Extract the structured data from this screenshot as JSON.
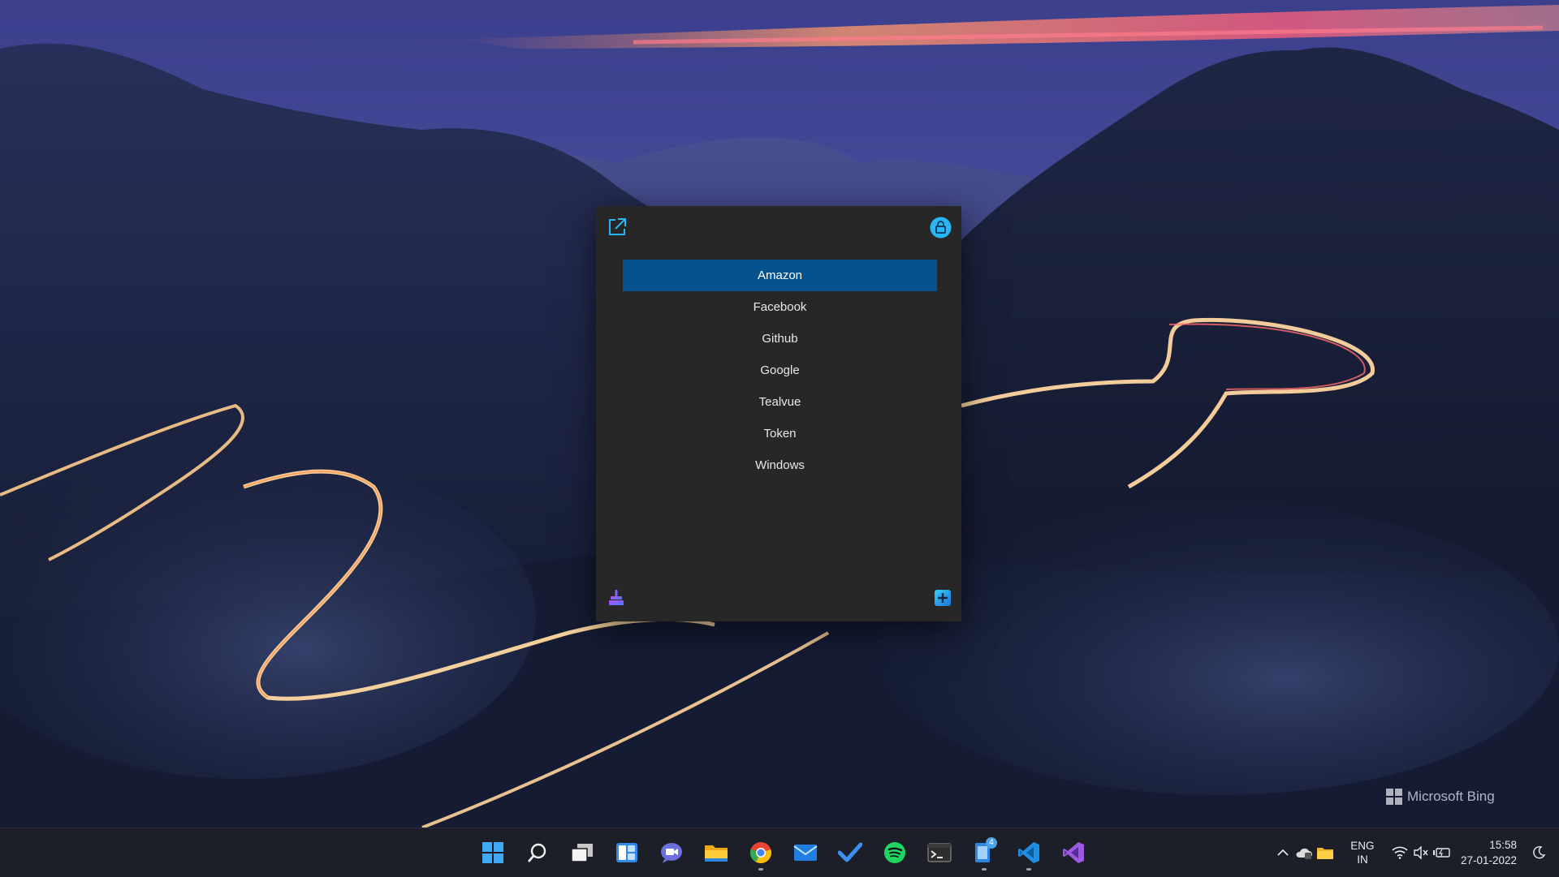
{
  "wallpaper": {
    "watermark": "Microsoft Bing"
  },
  "app": {
    "entries": [
      {
        "label": "Amazon",
        "selected": true
      },
      {
        "label": "Facebook",
        "selected": false
      },
      {
        "label": "Github",
        "selected": false
      },
      {
        "label": "Google",
        "selected": false
      },
      {
        "label": "Tealvue",
        "selected": false
      },
      {
        "label": "Token",
        "selected": false
      },
      {
        "label": "Windows",
        "selected": false
      }
    ],
    "icons": {
      "top_left": "open-external-icon",
      "top_right": "lock-icon",
      "bottom_left": "clean-icon",
      "bottom_right": "add-icon"
    },
    "colors": {
      "background": "#272727",
      "selected": "#06528f",
      "accent": "#29b6f6"
    }
  },
  "taskbar": {
    "apps": [
      {
        "name": "start",
        "icon": "windows-start-icon",
        "running": false
      },
      {
        "name": "search",
        "icon": "search-icon",
        "running": false
      },
      {
        "name": "task-view",
        "icon": "task-view-icon",
        "running": false
      },
      {
        "name": "widgets",
        "icon": "widgets-icon",
        "running": false
      },
      {
        "name": "teams-chat",
        "icon": "chat-icon",
        "running": false
      },
      {
        "name": "file-explorer",
        "icon": "folder-icon",
        "running": false
      },
      {
        "name": "chrome",
        "icon": "chrome-icon",
        "running": true
      },
      {
        "name": "mail",
        "icon": "mail-icon",
        "running": false
      },
      {
        "name": "todo",
        "icon": "checkmark-icon",
        "running": false
      },
      {
        "name": "spotify",
        "icon": "spotify-icon",
        "running": false
      },
      {
        "name": "terminal",
        "icon": "terminal-icon",
        "running": false
      },
      {
        "name": "authenticator",
        "icon": "authenticator-icon",
        "running": true,
        "badge": "4"
      },
      {
        "name": "vscode",
        "icon": "vscode-icon",
        "running": true
      },
      {
        "name": "visual-studio",
        "icon": "visual-studio-icon",
        "running": false
      }
    ],
    "tray": {
      "language": {
        "line1": "ENG",
        "line2": "IN"
      },
      "time": "15:58",
      "date": "27-01-2022",
      "icons": [
        "chevron-up-icon",
        "onedrive-icon",
        "folder-sync-icon",
        "wifi-icon",
        "volume-muted-icon",
        "battery-icon",
        "focus-moon-icon"
      ]
    }
  }
}
